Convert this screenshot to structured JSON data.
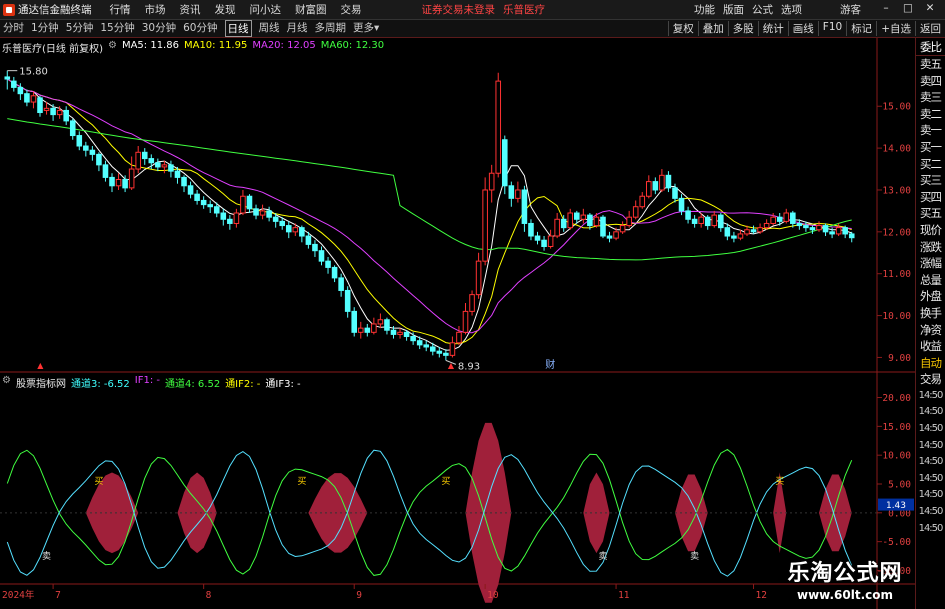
{
  "app": {
    "title": "通达信金融终端",
    "menu": [
      "行情",
      "市场",
      "资讯",
      "发现",
      "问小达",
      "财富圈",
      "交易"
    ],
    "notice": [
      "证券交易未登录",
      "乐普医疗"
    ],
    "right_menu": [
      "功能",
      "版面",
      "公式",
      "选项"
    ],
    "user": "游客",
    "window_controls": [
      "–",
      "□",
      "✕"
    ]
  },
  "tabs": {
    "items": [
      "分时",
      "1分钟",
      "5分钟",
      "15分钟",
      "30分钟",
      "60分钟",
      "日线",
      "周线",
      "月线",
      "多周期",
      "更多"
    ],
    "active_index": 6,
    "tools": [
      "复权",
      "叠加",
      "多股",
      "统计",
      "画线",
      "F10",
      "标记",
      "+自选",
      "返回"
    ]
  },
  "main_info": {
    "title": "乐普医疗(日线 前复权)",
    "ma5_label": "MA5: 11.86",
    "ma10_label": "MA10: 11.95",
    "ma20_label": "MA20: 12.05",
    "ma60_label": "MA60: 12.30",
    "high_label": "15.80",
    "low_label": "8.93",
    "event_mark": "财",
    "up_mark": "▲",
    "colors": {
      "ma5": "#ffffff",
      "ma10": "#ffff00",
      "ma20": "#e040ff",
      "ma60": "#40ff40"
    }
  },
  "sub_info": {
    "title": "股票指标网",
    "items": [
      "通道3: -6.52",
      "IF1: -",
      "通道4: 6.52",
      "通IF2: -",
      "通IF3: -"
    ],
    "badge": "1.43",
    "buy_mark": "买",
    "sell_mark": "卖",
    "colors": {
      "ch3": "#40ffff",
      "if1": "#e040ff",
      "ch4": "#40ff40",
      "if2": "#ffff00",
      "if3": "#ffffff"
    }
  },
  "main_axis": [
    "15.00",
    "14.00",
    "13.00",
    "12.00",
    "11.00",
    "10.00",
    "9.00"
  ],
  "sub_axis": [
    "20.00",
    "15.00",
    "10.00",
    "5.00",
    "0.00",
    "-5.00",
    "-10.00"
  ],
  "date_axis": [
    "2024年",
    "7",
    "8",
    "9",
    "10",
    "11",
    "12"
  ],
  "right_panel": {
    "first": "委比",
    "items": [
      "卖五",
      "卖四",
      "卖三",
      "卖二",
      "卖一",
      "买一",
      "买二",
      "买三",
      "买四",
      "买五",
      "现价",
      "涨跌",
      "涨幅",
      "总量",
      "外盘",
      "换手",
      "净资",
      "收益"
    ],
    "auto": "自动",
    "trade": "交易",
    "times": [
      "14:50",
      "14:50",
      "14:50",
      "14:50",
      "14:50",
      "14:50",
      "14:50",
      "14:50",
      "14:50"
    ]
  },
  "watermark": {
    "main": "乐淘公式网",
    "url": "www.60lt.com"
  },
  "chart_data": {
    "type": "candlestick",
    "ylim": [
      8.7,
      16.2
    ],
    "candles": [
      [
        15.7,
        15.65,
        15.85,
        15.4
      ],
      [
        15.6,
        15.45,
        15.7,
        15.35
      ],
      [
        15.45,
        15.3,
        15.55,
        15.15
      ],
      [
        15.3,
        15.1,
        15.4,
        15.0
      ],
      [
        15.1,
        15.25,
        15.35,
        14.95
      ],
      [
        15.2,
        14.85,
        15.25,
        14.75
      ],
      [
        14.9,
        14.95,
        15.1,
        14.8
      ],
      [
        14.95,
        14.8,
        15.05,
        14.65
      ],
      [
        14.8,
        14.9,
        15.0,
        14.7
      ],
      [
        14.9,
        14.65,
        15.0,
        14.55
      ],
      [
        14.65,
        14.3,
        14.7,
        14.2
      ],
      [
        14.3,
        14.05,
        14.4,
        13.95
      ],
      [
        14.05,
        13.95,
        14.15,
        13.8
      ],
      [
        13.95,
        13.85,
        14.05,
        13.7
      ],
      [
        13.85,
        13.6,
        13.9,
        13.45
      ],
      [
        13.6,
        13.3,
        13.7,
        13.2
      ],
      [
        13.3,
        13.1,
        13.4,
        12.95
      ],
      [
        13.1,
        13.25,
        13.4,
        13.0
      ],
      [
        13.25,
        13.05,
        13.35,
        12.95
      ],
      [
        13.05,
        13.5,
        13.8,
        13.0
      ],
      [
        13.5,
        13.9,
        14.05,
        13.4
      ],
      [
        13.9,
        13.75,
        14.0,
        13.6
      ],
      [
        13.75,
        13.65,
        13.85,
        13.5
      ],
      [
        13.65,
        13.55,
        13.75,
        13.45
      ],
      [
        13.55,
        13.6,
        13.7,
        13.4
      ],
      [
        13.6,
        13.45,
        13.7,
        13.3
      ],
      [
        13.45,
        13.3,
        13.55,
        13.15
      ],
      [
        13.3,
        13.1,
        13.35,
        12.95
      ],
      [
        13.1,
        12.9,
        13.2,
        12.8
      ],
      [
        12.9,
        12.75,
        13.0,
        12.65
      ],
      [
        12.75,
        12.65,
        12.85,
        12.55
      ],
      [
        12.65,
        12.6,
        12.75,
        12.45
      ],
      [
        12.6,
        12.45,
        12.7,
        12.35
      ],
      [
        12.45,
        12.3,
        12.55,
        12.15
      ],
      [
        12.3,
        12.2,
        12.4,
        12.05
      ],
      [
        12.2,
        12.45,
        12.55,
        12.1
      ],
      [
        12.45,
        12.85,
        13.0,
        12.4
      ],
      [
        12.85,
        12.55,
        12.9,
        12.45
      ],
      [
        12.55,
        12.4,
        12.65,
        12.3
      ],
      [
        12.4,
        12.5,
        12.65,
        12.3
      ],
      [
        12.5,
        12.35,
        12.6,
        12.25
      ],
      [
        12.35,
        12.25,
        12.45,
        12.1
      ],
      [
        12.25,
        12.15,
        12.35,
        12.05
      ],
      [
        12.15,
        12.0,
        12.25,
        11.85
      ],
      [
        12.0,
        12.1,
        12.2,
        11.9
      ],
      [
        12.1,
        11.9,
        12.15,
        11.75
      ],
      [
        11.9,
        11.7,
        12.0,
        11.6
      ],
      [
        11.7,
        11.55,
        11.8,
        11.4
      ],
      [
        11.55,
        11.3,
        11.65,
        11.2
      ],
      [
        11.3,
        11.15,
        11.4,
        11.0
      ],
      [
        11.15,
        10.9,
        11.2,
        10.8
      ],
      [
        10.9,
        10.6,
        11.0,
        10.45
      ],
      [
        10.6,
        10.1,
        10.7,
        9.95
      ],
      [
        10.1,
        9.6,
        10.2,
        9.5
      ],
      [
        9.6,
        9.7,
        9.85,
        9.45
      ],
      [
        9.7,
        9.6,
        9.8,
        9.5
      ],
      [
        9.6,
        9.8,
        9.95,
        9.55
      ],
      [
        9.8,
        9.9,
        10.05,
        9.7
      ],
      [
        9.9,
        9.65,
        9.95,
        9.55
      ],
      [
        9.65,
        9.55,
        9.75,
        9.45
      ],
      [
        9.55,
        9.6,
        9.7,
        9.45
      ],
      [
        9.6,
        9.5,
        9.65,
        9.4
      ],
      [
        9.5,
        9.4,
        9.6,
        9.3
      ],
      [
        9.4,
        9.3,
        9.5,
        9.2
      ],
      [
        9.3,
        9.25,
        9.4,
        9.15
      ],
      [
        9.25,
        9.15,
        9.35,
        9.05
      ],
      [
        9.15,
        9.1,
        9.25,
        9.0
      ],
      [
        9.1,
        9.05,
        9.2,
        8.93
      ],
      [
        9.05,
        9.35,
        9.5,
        9.0
      ],
      [
        9.35,
        9.6,
        9.75,
        9.3
      ],
      [
        9.6,
        10.1,
        10.3,
        9.55
      ],
      [
        10.1,
        10.5,
        10.6,
        10.0
      ],
      [
        10.5,
        11.3,
        11.5,
        10.4
      ],
      [
        11.3,
        13.0,
        13.3,
        11.2
      ],
      [
        13.0,
        13.4,
        13.6,
        12.7
      ],
      [
        13.4,
        15.6,
        15.8,
        13.3
      ],
      [
        14.2,
        13.1,
        14.3,
        12.9
      ],
      [
        13.1,
        12.8,
        13.2,
        12.6
      ],
      [
        12.8,
        13.0,
        13.2,
        12.7
      ],
      [
        13.0,
        12.2,
        13.1,
        12.0
      ],
      [
        12.2,
        11.9,
        12.3,
        11.8
      ],
      [
        11.9,
        11.8,
        12.0,
        11.7
      ],
      [
        11.8,
        11.65,
        11.9,
        11.55
      ],
      [
        11.65,
        11.9,
        12.05,
        11.6
      ],
      [
        11.9,
        12.3,
        12.45,
        11.85
      ],
      [
        12.3,
        12.1,
        12.4,
        12.0
      ],
      [
        12.1,
        12.45,
        12.55,
        12.05
      ],
      [
        12.45,
        12.3,
        12.5,
        12.2
      ],
      [
        12.3,
        12.4,
        12.55,
        12.2
      ],
      [
        12.4,
        12.15,
        12.45,
        12.05
      ],
      [
        12.15,
        12.35,
        12.45,
        12.1
      ],
      [
        12.35,
        11.9,
        12.4,
        11.85
      ],
      [
        11.9,
        11.85,
        12.0,
        11.75
      ],
      [
        11.85,
        12.0,
        12.1,
        11.8
      ],
      [
        12.0,
        12.15,
        12.25,
        11.95
      ],
      [
        12.15,
        12.35,
        12.5,
        12.1
      ],
      [
        12.35,
        12.6,
        12.75,
        12.3
      ],
      [
        12.6,
        12.85,
        12.95,
        12.55
      ],
      [
        12.85,
        13.2,
        13.35,
        12.8
      ],
      [
        13.2,
        13.0,
        13.3,
        12.9
      ],
      [
        13.0,
        13.35,
        13.5,
        12.95
      ],
      [
        13.35,
        13.05,
        13.45,
        12.95
      ],
      [
        13.05,
        12.8,
        13.15,
        12.7
      ],
      [
        12.8,
        12.5,
        12.9,
        12.4
      ],
      [
        12.5,
        12.3,
        12.6,
        12.2
      ],
      [
        12.3,
        12.2,
        12.4,
        12.1
      ],
      [
        12.2,
        12.35,
        12.45,
        12.1
      ],
      [
        12.35,
        12.15,
        12.4,
        12.05
      ],
      [
        12.15,
        12.4,
        12.5,
        12.1
      ],
      [
        12.4,
        12.1,
        12.45,
        12.0
      ],
      [
        12.1,
        11.9,
        12.2,
        11.8
      ],
      [
        11.9,
        11.85,
        12.0,
        11.75
      ],
      [
        11.85,
        11.95,
        12.05,
        11.8
      ],
      [
        11.95,
        12.05,
        12.15,
        11.9
      ],
      [
        12.05,
        12.0,
        12.15,
        11.95
      ],
      [
        12.0,
        12.1,
        12.2,
        11.95
      ],
      [
        12.1,
        12.2,
        12.3,
        12.05
      ],
      [
        12.2,
        12.35,
        12.45,
        12.15
      ],
      [
        12.35,
        12.25,
        12.45,
        12.15
      ],
      [
        12.25,
        12.45,
        12.55,
        12.2
      ],
      [
        12.45,
        12.2,
        12.5,
        12.1
      ],
      [
        12.2,
        12.15,
        12.3,
        12.05
      ],
      [
        12.15,
        12.1,
        12.25,
        12.0
      ],
      [
        12.1,
        12.05,
        12.15,
        11.95
      ],
      [
        12.05,
        12.15,
        12.25,
        12.0
      ],
      [
        12.15,
        12.0,
        12.2,
        11.9
      ],
      [
        12.0,
        11.95,
        12.1,
        11.85
      ],
      [
        11.95,
        12.1,
        12.2,
        11.9
      ],
      [
        12.1,
        11.95,
        12.15,
        11.85
      ],
      [
        11.95,
        11.86,
        12.0,
        11.75
      ]
    ],
    "sub_ylim": [
      -12,
      22
    ]
  }
}
